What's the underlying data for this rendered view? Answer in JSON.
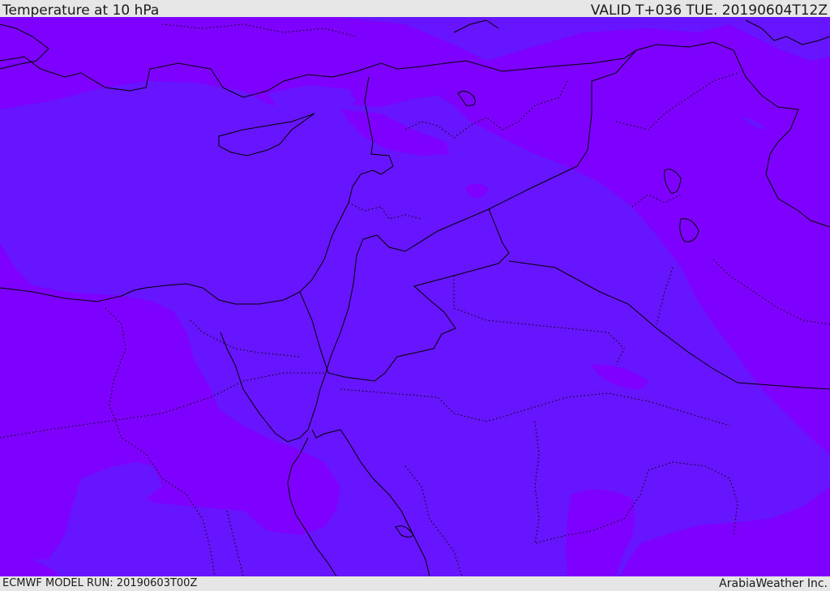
{
  "header": {
    "title": "Temperature at 10 hPa",
    "valid": "VALID T+036 TUE. 20190604T12Z"
  },
  "footer": {
    "model_run": "ECMWF MODEL RUN: 20190603T00Z",
    "brand": "ArabiaWeather Inc."
  },
  "colors": {
    "band_warm": "#7e00ff",
    "band_cool": "#6715ff",
    "border": "#000000",
    "frame": "#e6e6e6"
  }
}
